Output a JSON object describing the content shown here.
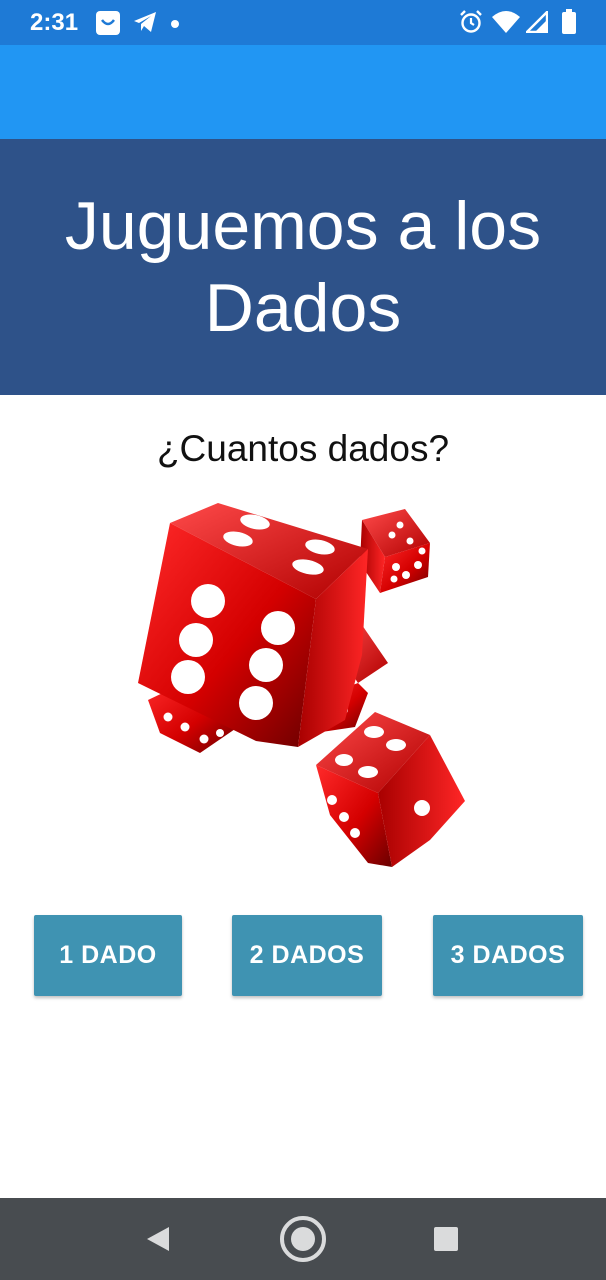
{
  "status_bar": {
    "time": "2:31",
    "left_icons": [
      "smile-notification-icon",
      "telegram-icon",
      "dot-icon"
    ],
    "right_icons": [
      "alarm-icon",
      "wifi-icon",
      "signal-icon",
      "battery-icon"
    ],
    "color": "#1e7ad6"
  },
  "app_bar": {
    "color": "#2196f3"
  },
  "banner": {
    "title_line1": "Juguemos a los",
    "title_line2": "Dados",
    "color": "#2e5289"
  },
  "main": {
    "question": "¿Cuantos dados?",
    "image": "red-dice-image"
  },
  "buttons": {
    "one": "1 DADO",
    "two": "2 DADOS",
    "three": "3 DADOS",
    "color": "#3f93b2"
  },
  "nav_bar": {
    "items": [
      "back-icon",
      "home-icon",
      "recents-icon"
    ],
    "color": "#484c50"
  }
}
